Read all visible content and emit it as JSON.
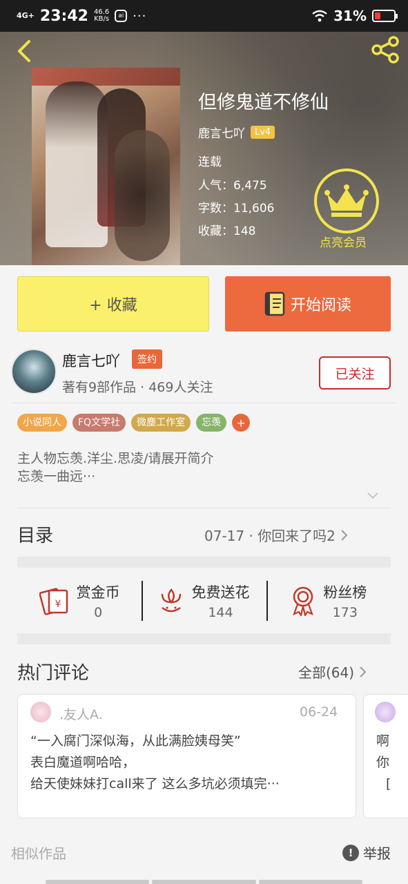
{
  "status_bar": {
    "network": "4G+",
    "time": "23:42",
    "speed_value": "46.6",
    "speed_unit": "KB/s",
    "app_icon": "ai-app-icon",
    "more": "···",
    "battery_pct": "31%",
    "battery_level": 0.31,
    "battery_color": "#ff3b3b"
  },
  "book": {
    "title": "但修鬼道不修仙",
    "author": "鹿言七吖",
    "level": "Lv4",
    "status": "连载",
    "popularity": "人气：6,475",
    "word_count": "字数：11,606",
    "collections": "收藏：148"
  },
  "vip": {
    "label": "点亮会员",
    "color": "#f3e44f"
  },
  "actions": {
    "collect_label": "+ 收藏",
    "read_label": "开始阅读"
  },
  "author_card": {
    "name": "鹿言七吖",
    "badge": "签约",
    "info": "著有9部作品 · 469人关注",
    "follow_label": "已关注"
  },
  "tags": [
    {
      "label": "小说同人",
      "color": "#f1a64a"
    },
    {
      "label": "FQ文学社",
      "color": "#c77a6e"
    },
    {
      "label": "微塵工作室",
      "color": "#d1a84c"
    },
    {
      "label": "忘羡",
      "color": "#86b56a"
    }
  ],
  "intro": {
    "line1": "主人物忘羡.洋尘.思凌/请展开简介",
    "line2": "忘羡一曲远···"
  },
  "toc": {
    "label": "目录",
    "latest": "07-17 · 你回来了吗2"
  },
  "stats": [
    {
      "label": "赏金币",
      "value": "0",
      "icon": "red-envelope-icon"
    },
    {
      "label": "免费送花",
      "value": "144",
      "icon": "flower-icon"
    },
    {
      "label": "粉丝榜",
      "value": "173",
      "icon": "medal-icon"
    }
  ],
  "comments": {
    "label": "热门评论",
    "all_label": "全部(64)",
    "items": [
      {
        "user": ".友人A.",
        "date": "06-24",
        "line1": "“一入腐门深似海，从此满脸姨母笑”",
        "line2": "表白魔道啊哈哈，",
        "line3": "给天使妹妹打call来了 这么多坑必须填完···"
      }
    ],
    "next_preview": {
      "line1": "啊",
      "line2": "你",
      "line3": "["
    }
  },
  "footer": {
    "similar_label": "相似作品",
    "report_label": "举报",
    "report_icon": "!"
  },
  "colors": {
    "accent_orange": "#ec6a3e",
    "collect_yellow": "#fbf06b",
    "follow_red": "#c72a2a"
  }
}
